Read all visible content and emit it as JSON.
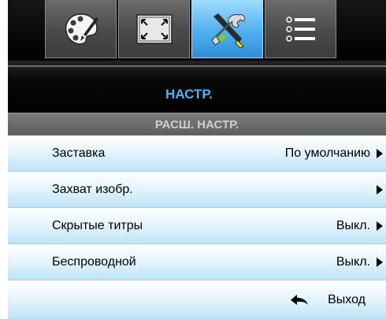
{
  "tabs": [
    {
      "icon": "palette-icon",
      "selected": false
    },
    {
      "icon": "fullscreen-icon",
      "selected": false
    },
    {
      "icon": "tools-icon",
      "selected": true
    },
    {
      "icon": "list-icon",
      "selected": false
    }
  ],
  "menu": {
    "title": "НАСТР.",
    "subtitle": "РАСШ. НАСТР.",
    "items": [
      {
        "label": "Заставка",
        "value": "По умолчанию"
      },
      {
        "label": "Захват изобр.",
        "value": ""
      },
      {
        "label": "Скрытые титры",
        "value": "Выкл."
      },
      {
        "label": "Беспроводной",
        "value": "Выкл."
      }
    ],
    "exit_label": "Выход"
  },
  "colors": {
    "title": "#49b3ff",
    "selected_tab": "#4fb0ee",
    "row_bg": "#cde9f8"
  }
}
